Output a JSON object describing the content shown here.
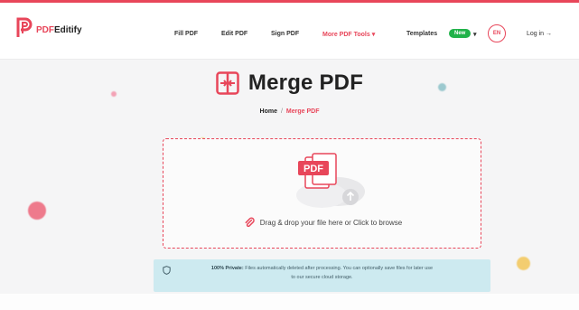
{
  "brand": {
    "logo_prefix": "PDF",
    "logo_suffix": "Editify",
    "accent": "#e8465a"
  },
  "nav": {
    "items": [
      "Fill PDF",
      "Edit PDF",
      "Sign PDF",
      "More PDF Tools",
      "Templates"
    ],
    "more_caret": "▾",
    "templates_badge": "New",
    "templates_caret": "▾",
    "language": "EN",
    "login": "Log in →"
  },
  "page": {
    "title": "Merge PDF",
    "breadcrumb": {
      "home": "Home",
      "separator": "/",
      "current": "Merge PDF"
    }
  },
  "dropzone": {
    "file_badge": "PDF",
    "instruction": "Drag & drop your file here or Click to browse"
  },
  "notice": {
    "bold": "100% Private:",
    "line1": "Files automatically deleted after processing. You can optionally save files for later use",
    "line2": "to our secure cloud storage."
  },
  "colors": {
    "accent": "#e8465a",
    "notice_bg": "#cdeaf0",
    "badge_green": "#21b24a"
  }
}
